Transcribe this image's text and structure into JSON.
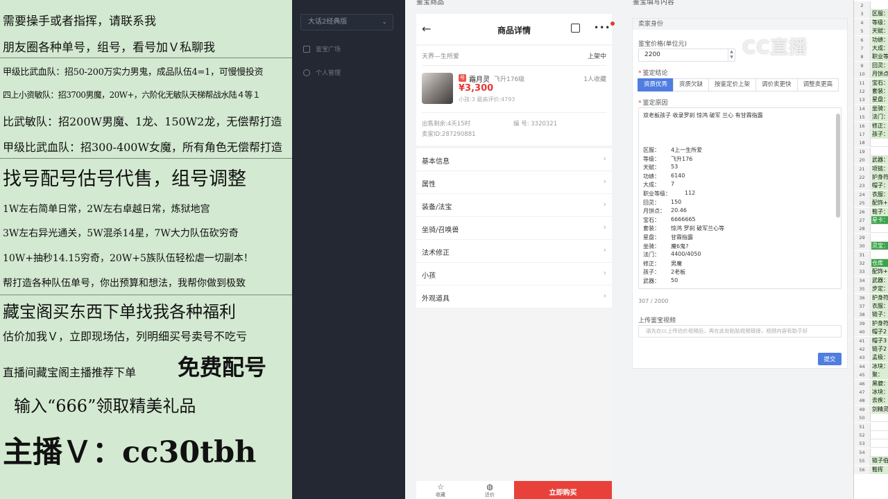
{
  "overlay": {
    "lines": [
      "需要操手或者指挥，请联系我",
      "朋友圈各种单号，组号，看号加Ｖ私聊我",
      "甲级比武血队：招50-200万实力男鬼，成品队伍4=1，可慢慢投资",
      "四上小资敏队：招3700男魔，20W+，六阶化无敏队天梯帮战水陆４等１",
      "比武敏队：招200W男魔、1龙、150W2龙，无偿帮打造",
      "甲级比武血队：招300-400W女魔，所有角色无偿帮打造",
      "找号配号估号代售，组号调整",
      "1W左右简单日常，2W左右卓越日常，炼狱地宫",
      "3W左右异光通关，5W混杀14星，7W大力队伍砍穷奇",
      "10W+抽秒14.15穷奇，20W+5族队伍轻松虐一切副本！",
      "帮打造各种队伍单号，你出预算和想法，我帮你做到极致",
      "藏宝阁买东西下单找我各种福利",
      "估价加我Ｖ，立即现场估，列明细买号卖号不吃亏",
      "直播间藏宝阁主播推荐下单",
      "免费配号",
      "输入“666”领取精美礼品",
      "主播Ｖ：cc30tbh"
    ]
  },
  "sidebar": {
    "select_value": "大话2经典版",
    "nav": [
      {
        "label": "鉴宝广场"
      },
      {
        "label": "个人管理"
      }
    ]
  },
  "headings": {
    "left": "鉴宝商品",
    "right": "鉴宝填写内容"
  },
  "phone": {
    "title": "商品详情",
    "server": "天界—生所爱",
    "status": "上架中",
    "seller_badge": "号",
    "seller_name": "霜月灵",
    "level": "飞升176级",
    "fav": "1人收藏",
    "price": "¥3,300",
    "meta": "小孩:3  最高评价:4793",
    "remaining": "出售剩余:4天15时",
    "code": "编    号: 3320321",
    "seller_id": "卖家ID:287290881",
    "menu": [
      "基本信息",
      "属性",
      "装备/法宝",
      "坐骑/召唤兽",
      "法术修正",
      "小孩",
      "外观道具"
    ],
    "bottom": {
      "fav_label": "收藏",
      "bargain_label": "还价",
      "buy_label": "立即购买"
    }
  },
  "form": {
    "section_identity": "卖家身份",
    "price_label": "鉴宝价格(单位元)",
    "price_value": "2200",
    "conclusion_label": "鉴定结论",
    "options": [
      "资质优秀",
      "资质欠缺",
      "按鉴定价上架",
      "调价卖更快",
      "调整卖更高"
    ],
    "active_option": "资质优秀",
    "reason_label": "鉴定原因",
    "reason_first": "双老板孩子 收录罗刹 惊鸿 破军 兰心 有甘霖指露",
    "reason_lines": [
      {
        "k": "区服：",
        "v": "4上一生所爱"
      },
      {
        "k": "等级：",
        "v": "飞升176"
      },
      {
        "k": "天赋：",
        "v": "53"
      },
      {
        "k": "功绩：",
        "v": "6140"
      },
      {
        "k": "大成：",
        "v": "7"
      },
      {
        "k": "职业等级：",
        "v": "112"
      },
      {
        "k": "回灵：",
        "v": "150"
      },
      {
        "k": "月饼点：",
        "v": "20.46"
      },
      {
        "k": "宝石：",
        "v": "6666665"
      },
      {
        "k": "套装：",
        "v": "惊鸿 罗刹 破军兰心等"
      },
      {
        "k": "星盘：",
        "v": "甘霖指露"
      },
      {
        "k": "坐骑：",
        "v": "魔6鬼?"
      },
      {
        "k": "法门：",
        "v": "4400/4050"
      },
      {
        "k": "修正：",
        "v": "男魔"
      },
      {
        "k": "孩子：",
        "v": "2老板"
      },
      {
        "k": "武器：",
        "v": "50"
      }
    ],
    "counter": "307 / 2000",
    "video_label": "上传鉴宝视频",
    "video_placeholder": "请先在cc上传估价视频后，再在此处粘贴视频链接，视频内容有助于好",
    "submit_label": "提交"
  },
  "watermark": "CC直播",
  "sheet": {
    "rows": [
      {
        "n": "2",
        "t": ""
      },
      {
        "n": "3",
        "t": "区服："
      },
      {
        "n": "4",
        "t": "等级："
      },
      {
        "n": "5",
        "t": "天赋："
      },
      {
        "n": "6",
        "t": "功绩："
      },
      {
        "n": "7",
        "t": "大成："
      },
      {
        "n": "8",
        "t": "职业等"
      },
      {
        "n": "9",
        "t": "回灵："
      },
      {
        "n": "10",
        "t": "月饼点"
      },
      {
        "n": "11",
        "t": "宝石："
      },
      {
        "n": "12",
        "t": "套装："
      },
      {
        "n": "13",
        "t": "星盘："
      },
      {
        "n": "14",
        "t": "坐骑："
      },
      {
        "n": "15",
        "t": "法门："
      },
      {
        "n": "16",
        "t": "修正："
      },
      {
        "n": "17",
        "t": "孩子："
      },
      {
        "n": "18",
        "t": ""
      },
      {
        "n": "19",
        "t": ""
      },
      {
        "n": "20",
        "t": "武器："
      },
      {
        "n": "21",
        "t": "项链："
      },
      {
        "n": "22",
        "t": "护身符"
      },
      {
        "n": "23",
        "t": "帽子："
      },
      {
        "n": "24",
        "t": "衣服："
      },
      {
        "n": "25",
        "t": "配饰+"
      },
      {
        "n": "26",
        "t": "鞋子："
      },
      {
        "n": "27",
        "t": "星卡："
      },
      {
        "n": "28",
        "t": ""
      },
      {
        "n": "29",
        "t": ""
      },
      {
        "n": "30",
        "t": "灵宝："
      },
      {
        "n": "31",
        "t": ""
      },
      {
        "n": "32",
        "t": "仓库"
      },
      {
        "n": "33",
        "t": "配饰+"
      },
      {
        "n": "34",
        "t": "武器："
      },
      {
        "n": "35",
        "t": "步定："
      },
      {
        "n": "36",
        "t": "护身符"
      },
      {
        "n": "37",
        "t": "衣服："
      },
      {
        "n": "38",
        "t": "链子："
      },
      {
        "n": "39",
        "t": "护身符"
      },
      {
        "n": "40",
        "t": "帽子2"
      },
      {
        "n": "41",
        "t": "帽子3"
      },
      {
        "n": "42",
        "t": "链子2"
      },
      {
        "n": "43",
        "t": "孟极："
      },
      {
        "n": "44",
        "t": "冰块："
      },
      {
        "n": "45",
        "t": "聚："
      },
      {
        "n": "46",
        "t": "黑貔："
      },
      {
        "n": "47",
        "t": "冰块："
      },
      {
        "n": "48",
        "t": "去疾："
      },
      {
        "n": "49",
        "t": "剑精灵"
      },
      {
        "n": "50",
        "t": ""
      },
      {
        "n": "51",
        "t": ""
      },
      {
        "n": "52",
        "t": ""
      },
      {
        "n": "53",
        "t": ""
      },
      {
        "n": "54",
        "t": ""
      },
      {
        "n": "55",
        "t": "链子伯"
      },
      {
        "n": "56",
        "t": "鞋挥"
      }
    ]
  }
}
